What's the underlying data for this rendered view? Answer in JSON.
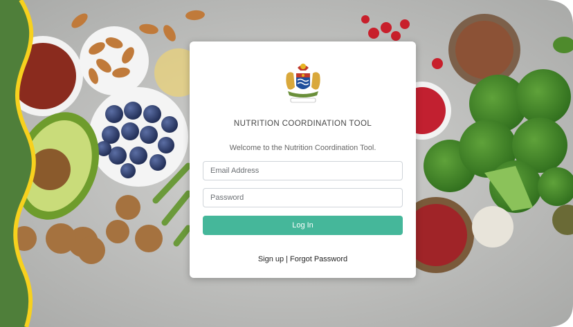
{
  "app": {
    "title": "NUTRITION COORDINATION TOOL",
    "welcome": "Welcome to the Nutrition Coordination Tool."
  },
  "login_form": {
    "email_placeholder": "Email Address",
    "password_placeholder": "Password",
    "submit_label": "Log In"
  },
  "links": {
    "signup_label": "Sign up",
    "separator": "|",
    "forgot_label": "Forgot Password"
  },
  "colors": {
    "primary_button": "#45b79a",
    "side_green": "#4f7f3a",
    "side_yellow": "#f7d11e"
  },
  "icons": {
    "emblem": "coat-of-arms-emblem"
  }
}
